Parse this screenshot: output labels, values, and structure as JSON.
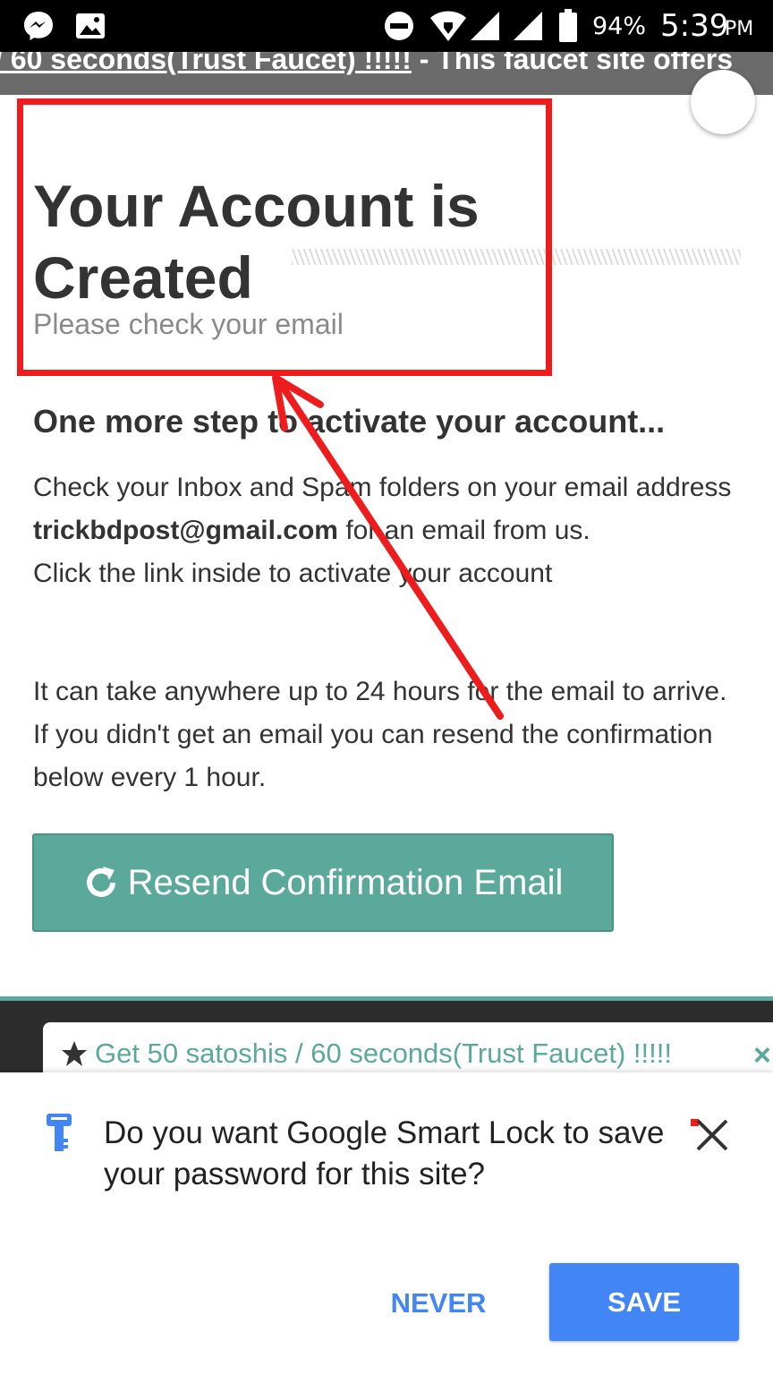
{
  "status_bar": {
    "battery": "94%",
    "time": "5:39",
    "ampm": "PM",
    "icons": [
      "messenger-icon",
      "gallery-icon",
      "do-not-disturb-icon",
      "wifi-icon",
      "signal-icon",
      "signal-icon",
      "battery-icon"
    ]
  },
  "marquee": {
    "link_text": "/ 60 seconds(Trust Faucet) !!!!!",
    "rest_text": " - This faucet site offers"
  },
  "page": {
    "headline": "Your Account is Created",
    "subheadline": "Please check your email",
    "step_title": "One more step to activate your account...",
    "p1_a": "Check your Inbox and Spam folders on your email address ",
    "p1_email": "trickbdpost@gmail.com",
    "p1_b": " for an email from us.",
    "p1_c": "Click the link inside to activate your account",
    "p2": "It can take anywhere up to 24 hours for the email to arrive. If you didn't get an email you can resend the confirmation below every 1 hour.",
    "resend_label": "Resend Confirmation Email"
  },
  "bookmark_bar": {
    "text": "Get 50 satoshis / 60 seconds(Trust Faucet) !!!!!",
    "close": "×"
  },
  "smart_lock": {
    "message": "Do you want Google Smart Lock to save your password for this site?",
    "never_label": "NEVER",
    "save_label": "SAVE"
  },
  "colors": {
    "annotation_red": "#ee1c1c",
    "button_teal": "#5aa99a",
    "google_blue": "#4285f4"
  }
}
